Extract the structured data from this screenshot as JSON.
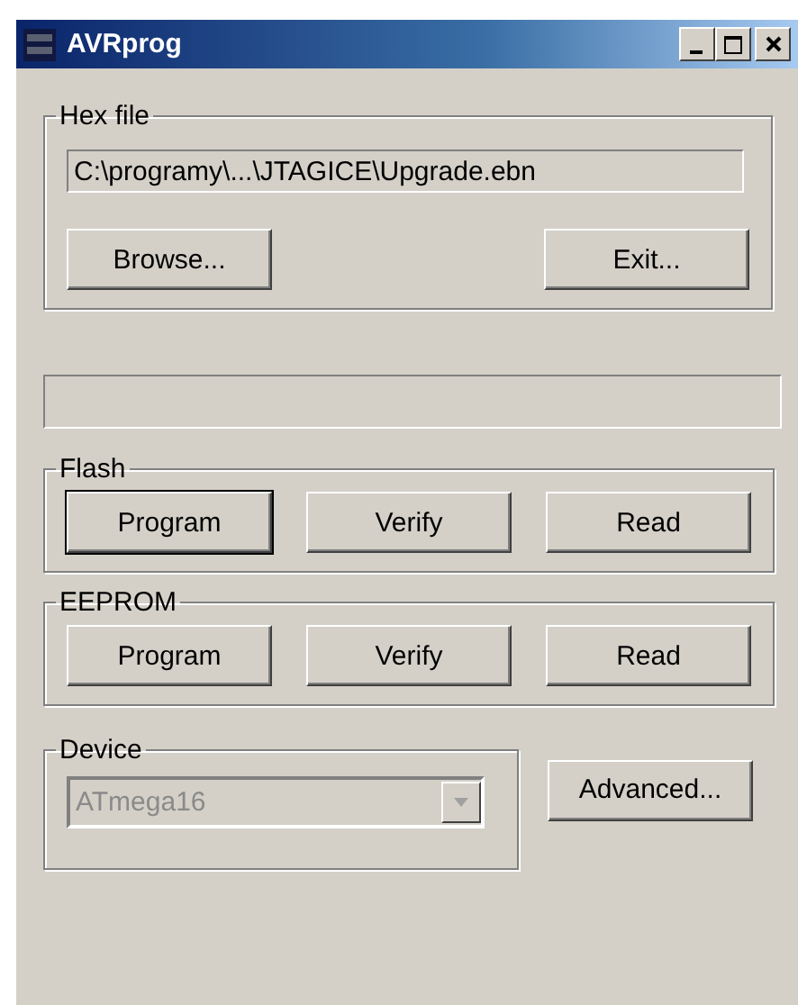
{
  "window": {
    "title": "AVRprog"
  },
  "hex_file": {
    "label": "Hex file",
    "path": "C:\\programy\\...\\JTAGICE\\Upgrade.ebn",
    "buttons": [
      {
        "label": "Browse...",
        "default": false
      },
      {
        "label": "Exit...",
        "default": false
      }
    ]
  },
  "progress_bar": {
    "level": 0
  },
  "flash": {
    "label": "Flash",
    "buttons": [
      {
        "label": "Program",
        "default": true
      },
      {
        "label": "Verify",
        "default": false
      },
      {
        "label": "Read",
        "default": false
      }
    ]
  },
  "eeprom": {
    "label": "EEPROM",
    "buttons": [
      {
        "label": "Program",
        "default": false
      },
      {
        "label": "Verify",
        "default": false
      },
      {
        "label": "Read",
        "default": false
      }
    ]
  },
  "device": {
    "label": "Device",
    "value": "ATmega16",
    "disabled": true
  },
  "advanced_button": {
    "label": "Advanced..."
  }
}
